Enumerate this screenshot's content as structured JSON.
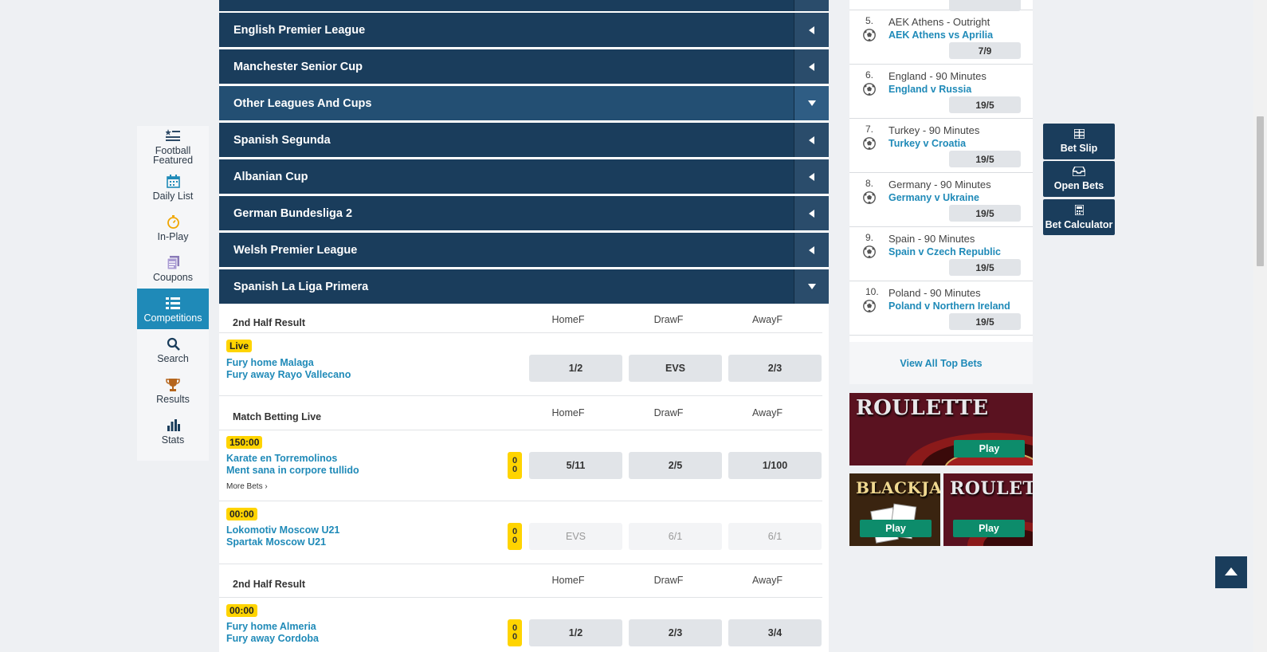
{
  "leftnav": {
    "items": [
      {
        "label": "Football Featured",
        "icon": "list-star-icon"
      },
      {
        "label": "Daily List",
        "icon": "calendar-icon"
      },
      {
        "label": "In-Play",
        "icon": "stopwatch-icon"
      },
      {
        "label": "Coupons",
        "icon": "coupons-icon"
      },
      {
        "label": "Competitions",
        "icon": "competitions-icon",
        "active": true
      },
      {
        "label": "Search",
        "icon": "search-icon"
      },
      {
        "label": "Results",
        "icon": "trophy-icon"
      },
      {
        "label": "Stats",
        "icon": "stats-icon"
      }
    ]
  },
  "leagues": [
    {
      "name": "English Premier League",
      "expanded": false
    },
    {
      "name": "Manchester Senior Cup",
      "expanded": false
    },
    {
      "name": "Other Leagues And Cups",
      "expanded": true
    },
    {
      "name": "Spanish Segunda",
      "expanded": false
    },
    {
      "name": "Albanian Cup",
      "expanded": false
    },
    {
      "name": "German Bundesliga 2",
      "expanded": false
    },
    {
      "name": "Welsh Premier League",
      "expanded": false
    },
    {
      "name": "Spanish La Liga Primera",
      "expanded": true
    }
  ],
  "markets": [
    {
      "title": "2nd Half Result",
      "cols": [
        "HomeF",
        "DrawF",
        "AwayF"
      ],
      "events": [
        {
          "badge": "Live",
          "home": "Fury home Malaga",
          "away": "Fury away Rayo Vallecano",
          "odds": [
            "1/2",
            "EVS",
            "2/3"
          ]
        }
      ]
    },
    {
      "title": "Match Betting Live",
      "cols": [
        "HomeF",
        "DrawF",
        "AwayF"
      ],
      "events": [
        {
          "badge": "150:00",
          "home": "Karate en Torremolinos",
          "away": "Ment sana in corpore tullido",
          "score": [
            "0",
            "0"
          ],
          "odds": [
            "5/11",
            "2/5",
            "1/100"
          ],
          "more": "More Bets ›"
        },
        {
          "badge": "00:00",
          "home": "Lokomotiv Moscow U21",
          "away": "Spartak Moscow U21",
          "score": [
            "0",
            "0"
          ],
          "odds": [
            "EVS",
            "6/1",
            "6/1"
          ],
          "disabled": true
        }
      ]
    },
    {
      "title": "2nd Half Result",
      "cols": [
        "HomeF",
        "DrawF",
        "AwayF"
      ],
      "events": [
        {
          "badge": "00:00",
          "home": "Fury home Almeria",
          "away": "Fury away Cordoba",
          "score": [
            "0",
            "0"
          ],
          "odds": [
            "1/2",
            "2/3",
            "3/4"
          ]
        }
      ]
    }
  ],
  "topbets": {
    "items": [
      {
        "num": "5.",
        "market": "AEK Athens - Outright",
        "event": "AEK Athens vs Aprilia",
        "price": "7/9"
      },
      {
        "num": "6.",
        "market": "England - 90 Minutes",
        "event": "England v Russia",
        "price": "19/5"
      },
      {
        "num": "7.",
        "market": "Turkey - 90 Minutes",
        "event": "Turkey v Croatia",
        "price": "19/5"
      },
      {
        "num": "8.",
        "market": "Germany - 90 Minutes",
        "event": "Germany v Ukraine",
        "price": "19/5"
      },
      {
        "num": "9.",
        "market": "Spain - 90 Minutes",
        "event": "Spain v Czech Republic",
        "price": "19/5"
      },
      {
        "num": "10.",
        "market": "Poland - 90 Minutes",
        "event": "Poland v Northern Ireland",
        "price": "19/5"
      }
    ],
    "view_all": "View All Top Bets"
  },
  "casino": {
    "roulette_big": {
      "title": "ROULETTE",
      "play": "Play"
    },
    "blackjack": {
      "title": "BLACKJAC",
      "play": "Play"
    },
    "roulette_small": {
      "title": "ROULETTE",
      "play": "Play"
    }
  },
  "tools": {
    "bet_slip": "Bet Slip",
    "open_bets": "Open Bets",
    "bet_calculator": "Bet Calculator"
  },
  "colors": {
    "navy": "#1a3d5c",
    "accent": "#1f8ab8",
    "badge": "#ffd400",
    "play": "#0d8c6b"
  }
}
